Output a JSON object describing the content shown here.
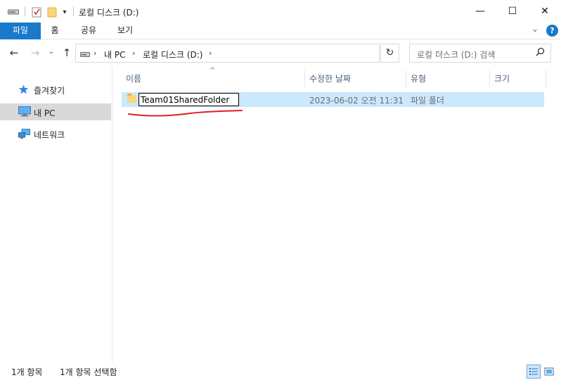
{
  "window": {
    "title": "로컬 디스크 (D:)",
    "controls": {
      "minimize": "—",
      "maximize": "☐",
      "close": "✕"
    }
  },
  "ribbon": {
    "tabs": [
      {
        "label": "파일",
        "active": true
      },
      {
        "label": "홈"
      },
      {
        "label": "공유"
      },
      {
        "label": "보기"
      }
    ],
    "expand_chevron": "⌄",
    "help": "?"
  },
  "nav": {
    "back": "←",
    "forward": "→",
    "recent": "⌄",
    "up": "↑",
    "breadcrumb": [
      {
        "label": "내 PC"
      },
      {
        "label": "로컬 디스크 (D:)"
      }
    ],
    "refresh": "↻",
    "search_placeholder": "로컬 디스크 (D:) 검색"
  },
  "sidebar": {
    "items": [
      {
        "label": "즐겨찾기",
        "icon": "star-icon"
      },
      {
        "label": "내 PC",
        "icon": "pc-icon",
        "selected": true
      },
      {
        "label": "네트워크",
        "icon": "network-icon"
      }
    ]
  },
  "columns": {
    "name": "이름",
    "modified": "수정한 날짜",
    "type": "유형",
    "size": "크기"
  },
  "files": [
    {
      "name": "Team01SharedFolder",
      "modified": "2023-06-02 오전 11:31",
      "type": "파일 폴더",
      "size": "",
      "renaming": true
    }
  ],
  "status": {
    "item_count": "1개 항목",
    "selected": "1개 항목 선택함"
  },
  "colors": {
    "accent": "#1979ca",
    "selection": "#cce8ff",
    "annotation": "#e02020"
  }
}
